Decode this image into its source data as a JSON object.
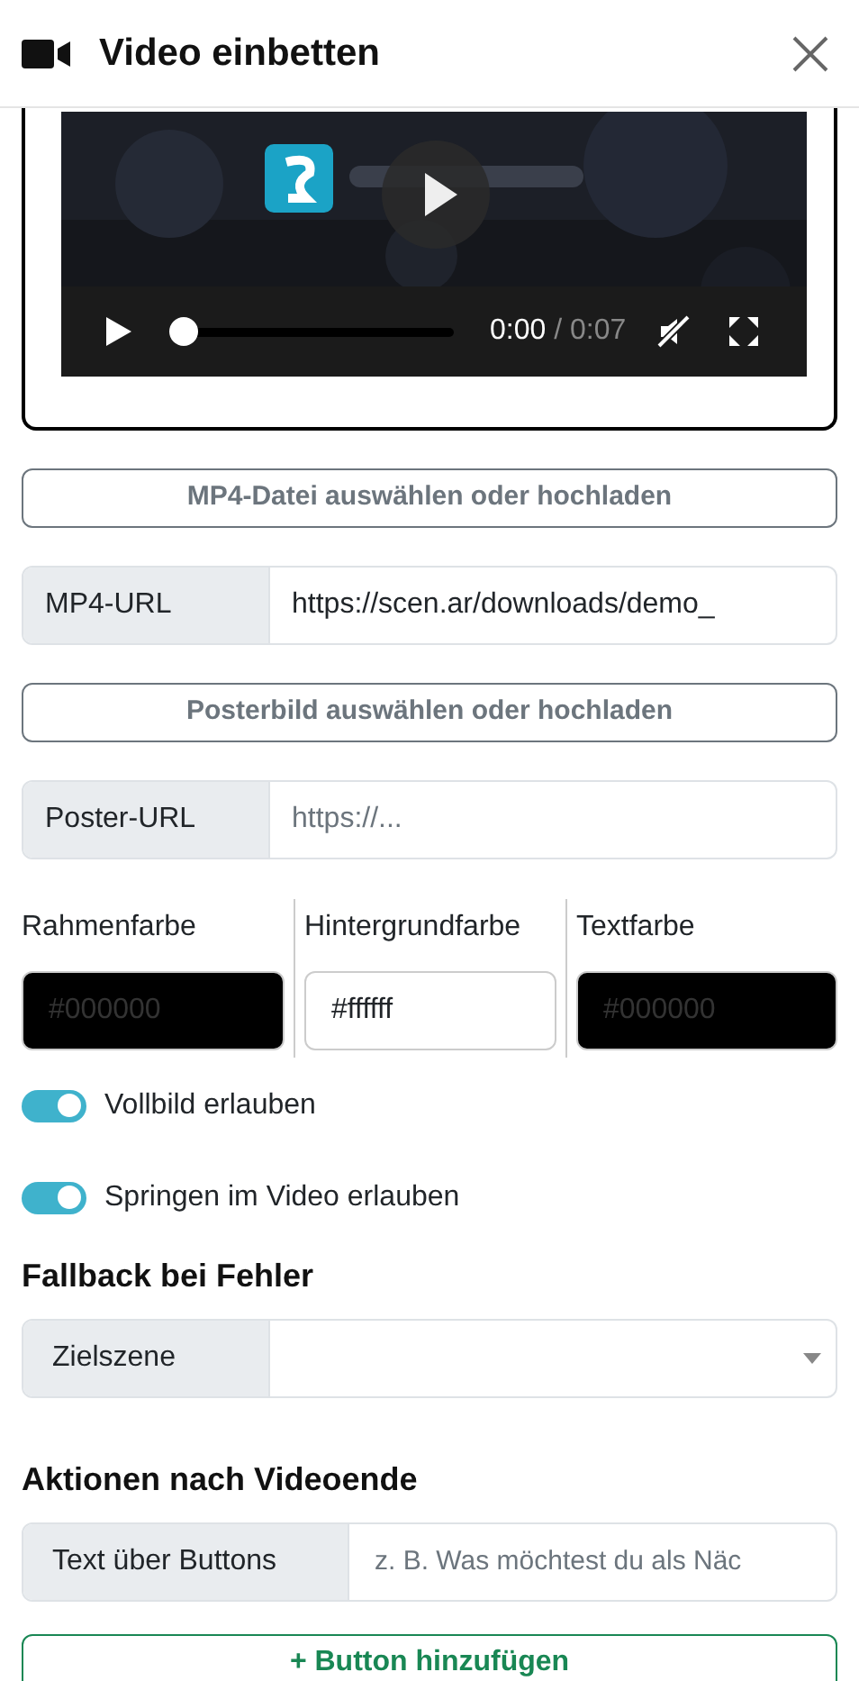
{
  "dialog": {
    "title": "Video einbetten"
  },
  "video_player": {
    "current_time": "0:00",
    "separator": "/",
    "duration": "0:07",
    "level": 0,
    "muted": true
  },
  "upload_video_button": "MP4-Datei auswählen oder hochladen",
  "mp4_url": {
    "label": "MP4-URL",
    "value": "https://scen.ar/downloads/demo_"
  },
  "upload_poster_button": "Posterbild auswählen oder hochladen",
  "poster_url": {
    "label": "Poster-URL",
    "placeholder": "https://..."
  },
  "colors": [
    {
      "label": "Rahmenfarbe",
      "placeholder": "#000000",
      "color": "#000000"
    },
    {
      "label": "Hintergrundfarbe",
      "value": "#ffffff",
      "color": "#ffffff"
    },
    {
      "label": "Textfarbe",
      "placeholder": "#000000",
      "color": "#000000"
    }
  ],
  "toggles": [
    {
      "label": "Vollbild erlauben",
      "on": true
    },
    {
      "label": "Springen im Video erlauben",
      "on": true
    }
  ],
  "fallback": {
    "heading": "Fallback bei Fehler",
    "select_label": "Zielszene"
  },
  "actions": {
    "heading": "Aktionen nach Videoende",
    "field_label": "Text über Buttons",
    "placeholder": "z. B. Was möchtest du als Näc",
    "add_button": "+ Button hinzufügen"
  }
}
